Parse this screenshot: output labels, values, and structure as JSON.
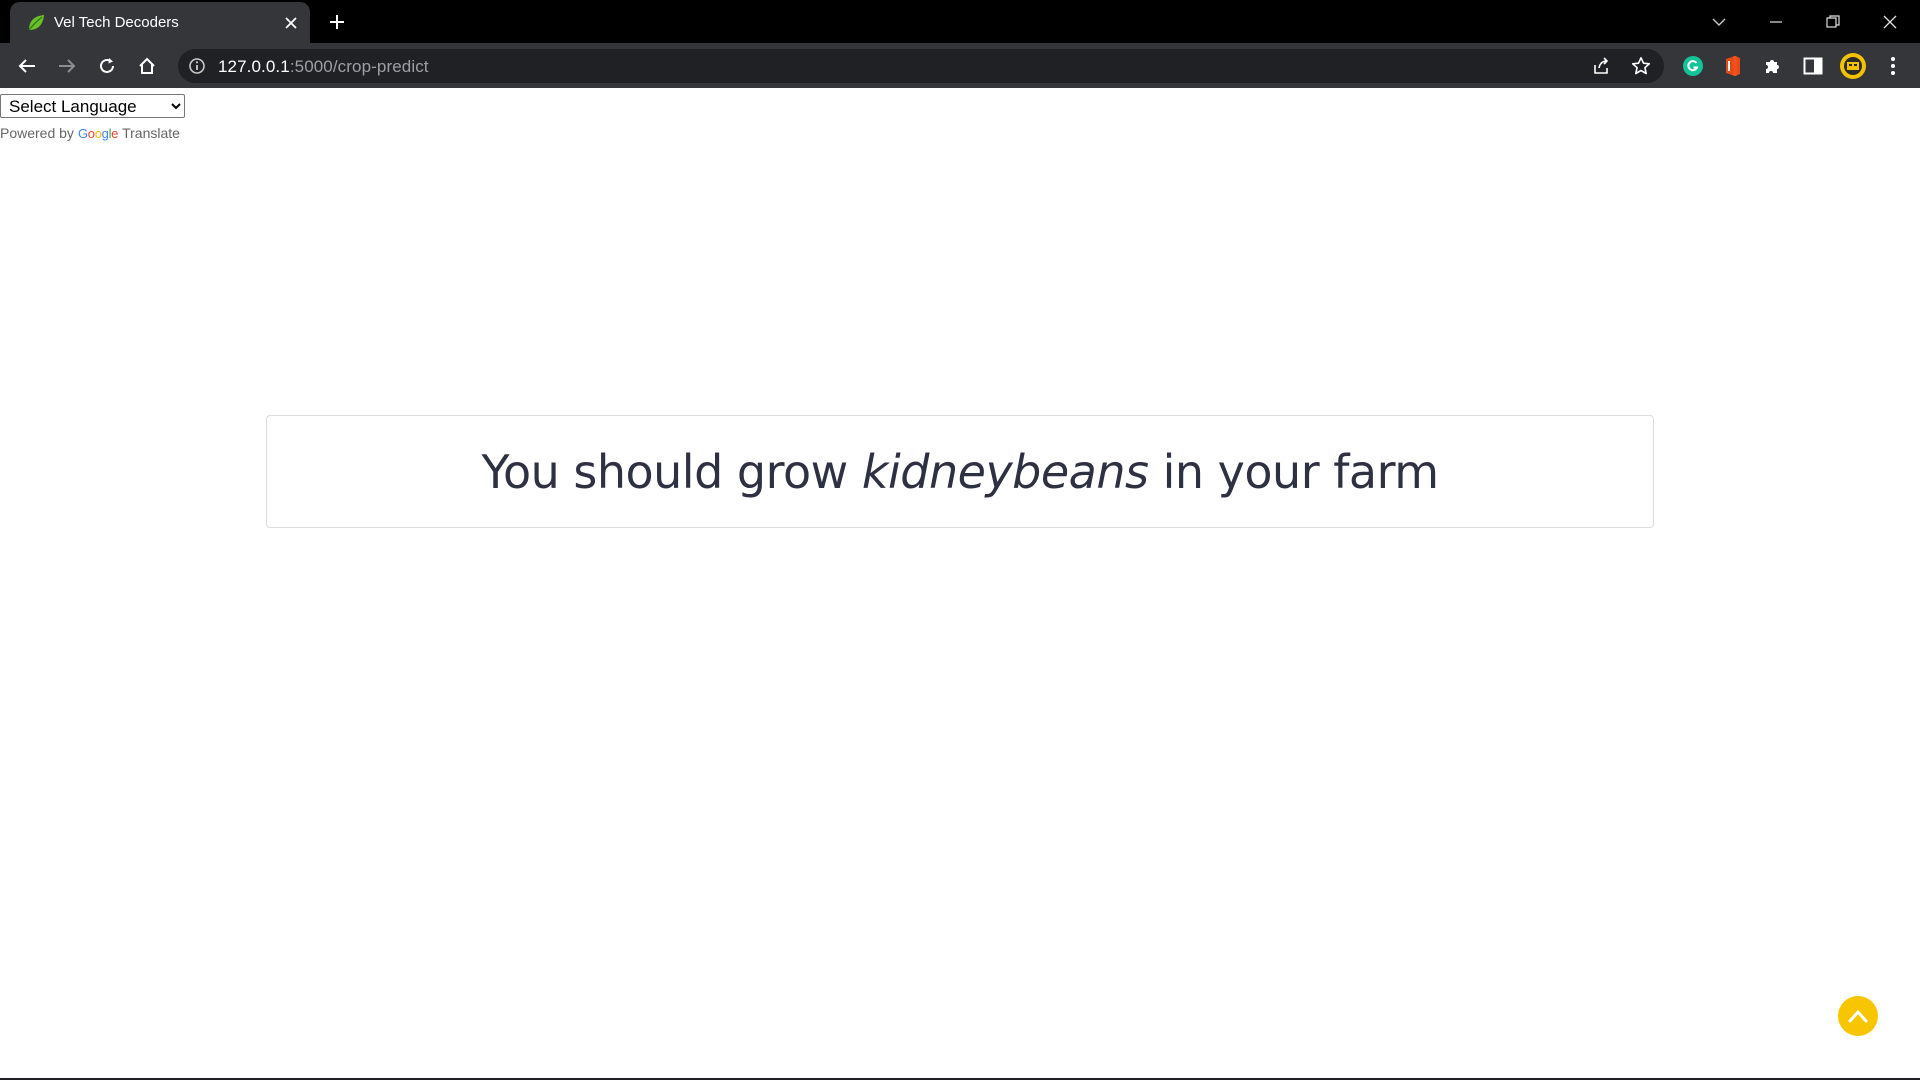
{
  "browser": {
    "tab": {
      "title": "Vel Tech Decoders",
      "favicon": "leaf-icon"
    },
    "address": {
      "host": "127.0.0.1",
      "path": ":5000/crop-predict"
    },
    "colors": {
      "frame": "#000000",
      "toolbar": "#35363a",
      "omnibox": "#202124"
    }
  },
  "translate": {
    "select_label": "Select Language",
    "powered_by": "Powered by",
    "google": [
      "G",
      "o",
      "o",
      "g",
      "l",
      "e"
    ],
    "translate_label": "Translate"
  },
  "result": {
    "prefix": "You should grow ",
    "crop": "kidneybeans",
    "suffix": " in your farm"
  },
  "colors": {
    "accent": "#f7c600",
    "text": "#2e3142"
  }
}
